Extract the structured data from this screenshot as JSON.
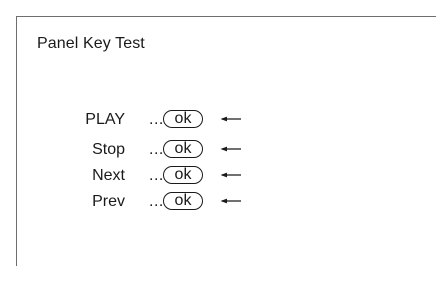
{
  "title": "Panel Key Test",
  "rows": [
    {
      "label": "PLAY",
      "dots": "...",
      "status": "ok"
    },
    {
      "label": "Stop",
      "dots": "...",
      "status": "ok"
    },
    {
      "label": "Next",
      "dots": "...",
      "status": "ok"
    },
    {
      "label": "Prev",
      "dots": "...",
      "status": "ok"
    }
  ]
}
